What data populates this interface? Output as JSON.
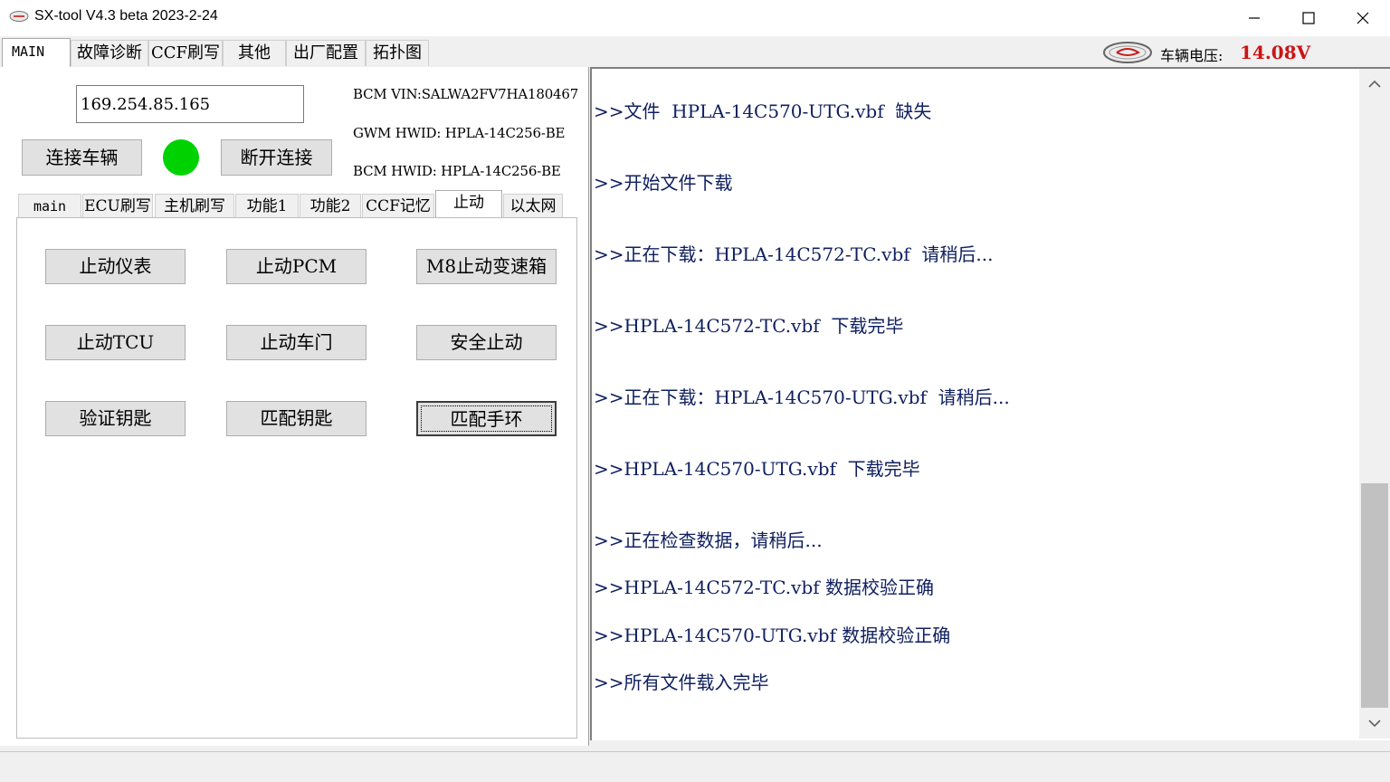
{
  "window": {
    "title": "SX-tool V4.3 beta 2023-2-24"
  },
  "main_tabs": [
    {
      "label": "MAIN",
      "active": true
    },
    {
      "label": "故障诊断"
    },
    {
      "label": "CCF刷写"
    },
    {
      "label": "其他"
    },
    {
      "label": "出厂配置"
    },
    {
      "label": "拓扑图"
    }
  ],
  "vehicle": {
    "voltage_label": "车辆电压:",
    "voltage_value": "14.08V",
    "voltage_color": "#cc1414"
  },
  "connection": {
    "ip_value": "169.254.85.165",
    "connect_label": "连接车辆",
    "disconnect_label": "断开连接",
    "status_color": "#00d200",
    "bcm_vin": "BCM VIN:SALWA2FV7HA180467",
    "gwm_hwid": "GWM HWID: HPLA-14C256-BE",
    "bcm_hwid": "BCM HWID: HPLA-14C256-BE"
  },
  "sub_tabs": [
    {
      "label": "main"
    },
    {
      "label": "ECU刷写"
    },
    {
      "label": "主机刷写"
    },
    {
      "label": "功能1"
    },
    {
      "label": "功能2"
    },
    {
      "label": "CCF记忆"
    },
    {
      "label": "止动",
      "active": true
    },
    {
      "label": "以太网"
    }
  ],
  "function_buttons": [
    {
      "label": "止动仪表"
    },
    {
      "label": "止动PCM"
    },
    {
      "label": "M8止动变速箱"
    },
    {
      "label": "止动TCU"
    },
    {
      "label": "止动车门"
    },
    {
      "label": "安全止动"
    },
    {
      "label": "验证钥匙"
    },
    {
      "label": "匹配钥匙"
    },
    {
      "label": "匹配手环",
      "focused": true
    }
  ],
  "log": {
    "lines": [
      ">>文件  HPLA-14C570-UTG.vbf  缺失",
      ">>开始文件下载",
      ">>正在下载：HPLA-14C572-TC.vbf  请稍后...",
      ">>HPLA-14C572-TC.vbf  下载完毕",
      ">>正在下载：HPLA-14C570-UTG.vbf  请稍后...",
      ">>HPLA-14C570-UTG.vbf  下载完毕",
      ">>正在检查数据，请稍后...",
      ">>HPLA-14C572-TC.vbf 数据校验正确",
      ">>HPLA-14C570-UTG.vbf 数据校验正确",
      ">>所有文件载入完毕"
    ],
    "text_color": "#102060"
  },
  "icons": {
    "app": "app-logo-icon",
    "minimize": "minimize-icon",
    "maximize": "maximize-icon",
    "close": "close-icon",
    "brand": "sx-brand-logo",
    "scroll_up": "chevron-up-icon",
    "scroll_down": "chevron-down-icon"
  }
}
